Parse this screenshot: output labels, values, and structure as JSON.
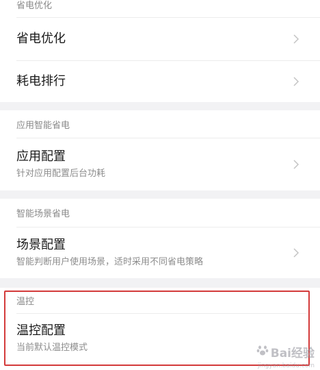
{
  "sections": [
    {
      "header": "省电优化",
      "items": [
        {
          "title": "省电优化",
          "subtitle": ""
        },
        {
          "title": "耗电排行",
          "subtitle": ""
        }
      ]
    },
    {
      "header": "应用智能省电",
      "items": [
        {
          "title": "应用配置",
          "subtitle": "针对应用配置后台功耗"
        }
      ]
    },
    {
      "header": "智能场景省电",
      "items": [
        {
          "title": "场景配置",
          "subtitle": "智能判断用户使用场景，适时采用不同省电策略"
        }
      ]
    },
    {
      "header": "温控",
      "items": [
        {
          "title": "温控配置",
          "subtitle": "当前默认温控模式"
        }
      ]
    }
  ],
  "watermark": {
    "text": "Bai经验",
    "sub": "jingyan.baidu.com"
  },
  "colors": {
    "highlight": "#d33a3a",
    "section_gap": "#f2f2f4"
  }
}
